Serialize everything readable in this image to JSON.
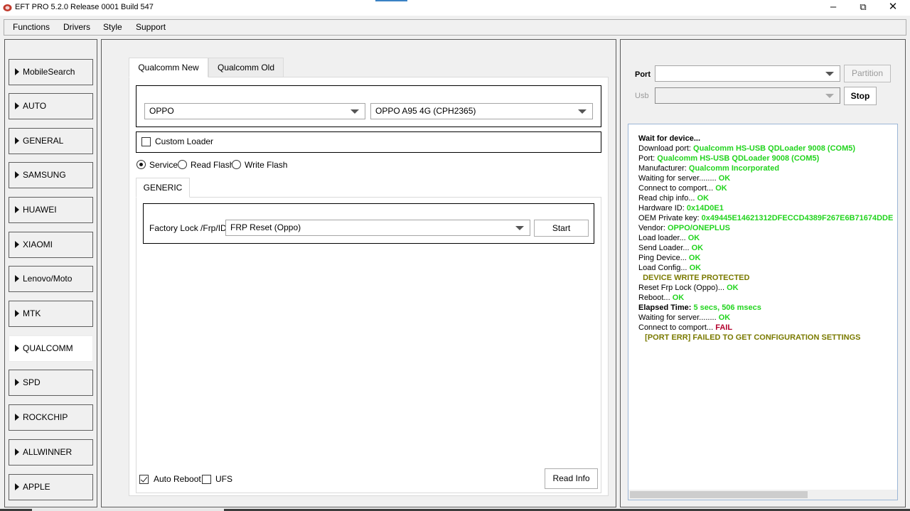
{
  "window": {
    "title": "EFT PRO 5.2.0 Release 0001 Build 547",
    "app_icon": "eft-app-icon",
    "controls": {
      "minimize": "–",
      "maximize": "⧉",
      "close": "✕"
    }
  },
  "menu": {
    "items": [
      "Functions",
      "Drivers",
      "Style",
      "Support"
    ]
  },
  "sidebar": {
    "items": [
      {
        "label": "MobileSearch",
        "active": false
      },
      {
        "label": "AUTO",
        "active": false
      },
      {
        "label": "GENERAL",
        "active": false
      },
      {
        "label": "SAMSUNG",
        "active": false
      },
      {
        "label": "HUAWEI",
        "active": false
      },
      {
        "label": "XIAOMI",
        "active": false
      },
      {
        "label": "Lenovo/Moto",
        "active": false
      },
      {
        "label": "MTK",
        "active": false
      },
      {
        "label": "QUALCOMM",
        "active": true
      },
      {
        "label": "SPD",
        "active": false
      },
      {
        "label": "ROCKCHIP",
        "active": false
      },
      {
        "label": "ALLWINNER",
        "active": false
      },
      {
        "label": "APPLE",
        "active": false
      }
    ]
  },
  "main": {
    "tabs": [
      {
        "label": "Qualcomm New",
        "active": true
      },
      {
        "label": "Qualcomm Old",
        "active": false
      }
    ],
    "brand_select": {
      "value": "OPPO"
    },
    "model_select": {
      "value": "OPPO A95 4G (CPH2365)"
    },
    "custom_loader": {
      "label": "Custom Loader",
      "checked": false
    },
    "mode_radios": [
      {
        "label": "Service",
        "checked": true
      },
      {
        "label": "Read Flash",
        "checked": false
      },
      {
        "label": "Write Flash",
        "checked": false
      }
    ],
    "subtab": {
      "label": "GENERIC"
    },
    "function_row": {
      "label": "Factory Lock /Frp/ID",
      "select_value": "FRP Reset (Oppo)",
      "start_label": "Start"
    },
    "auto_reboot": {
      "label": "Auto Reboot",
      "checked": true
    },
    "ufs": {
      "label": "UFS",
      "checked": false
    },
    "read_info_label": "Read Info"
  },
  "right_panel": {
    "port_label": "Port",
    "port_value": "",
    "usb_label": "Usb",
    "usb_value": "",
    "partition_label": "Partition",
    "stop_label": "Stop"
  },
  "colors": {
    "ok": "#22d41e",
    "fail": "#b3002d",
    "warn": "#7a7a00",
    "log_text": "#000000"
  },
  "log": [
    {
      "text": "Wait for device...",
      "result": "",
      "status": "bold"
    },
    {
      "text": "Download port: ",
      "result": "Qualcomm HS-USB QDLoader 9008 (COM5)",
      "status": "ok"
    },
    {
      "text": "Port: ",
      "result": "Qualcomm HS-USB QDLoader 9008 (COM5)",
      "status": "ok"
    },
    {
      "text": "Manufacturer: ",
      "result": "Qualcomm Incorporated",
      "status": "ok"
    },
    {
      "text": "Waiting for server........ ",
      "result": "OK",
      "status": "ok"
    },
    {
      "text": "Connect to comport... ",
      "result": "OK",
      "status": "ok"
    },
    {
      "text": "Read chip info... ",
      "result": "OK",
      "status": "ok"
    },
    {
      "text": "Hardware ID: ",
      "result": "0x14D0E1",
      "status": "ok"
    },
    {
      "text": "OEM Private key: ",
      "result": "0x49445E14621312DFECCD4389F267E6B71674DDE",
      "status": "ok"
    },
    {
      "text": "Vendor: ",
      "result": "OPPO/ONEPLUS",
      "status": "ok"
    },
    {
      "text": "Load loader... ",
      "result": "OK",
      "status": "ok"
    },
    {
      "text": "Send Loader... ",
      "result": "OK",
      "status": "ok"
    },
    {
      "text": "Ping Device... ",
      "result": "OK",
      "status": "ok"
    },
    {
      "text": "Load Config... ",
      "result": "OK",
      "status": "ok"
    },
    {
      "text": "  DEVICE WRITE PROTECTED",
      "result": "",
      "status": "warn"
    },
    {
      "text": "Reset Frp Lock (Oppo)... ",
      "result": "OK",
      "status": "ok"
    },
    {
      "text": "Reboot... ",
      "result": "OK",
      "status": "ok"
    },
    {
      "text": "Elapsed Time: ",
      "result": "5 secs, 506 msecs",
      "status": "okbold"
    },
    {
      "text": "Waiting for server........ ",
      "result": "OK",
      "status": "ok"
    },
    {
      "text": "Connect to comport... ",
      "result": "FAIL",
      "status": "fail"
    },
    {
      "text": "   [PORT ERR] FAILED TO GET CONFIGURATION SETTINGS",
      "result": "",
      "status": "warn"
    }
  ]
}
